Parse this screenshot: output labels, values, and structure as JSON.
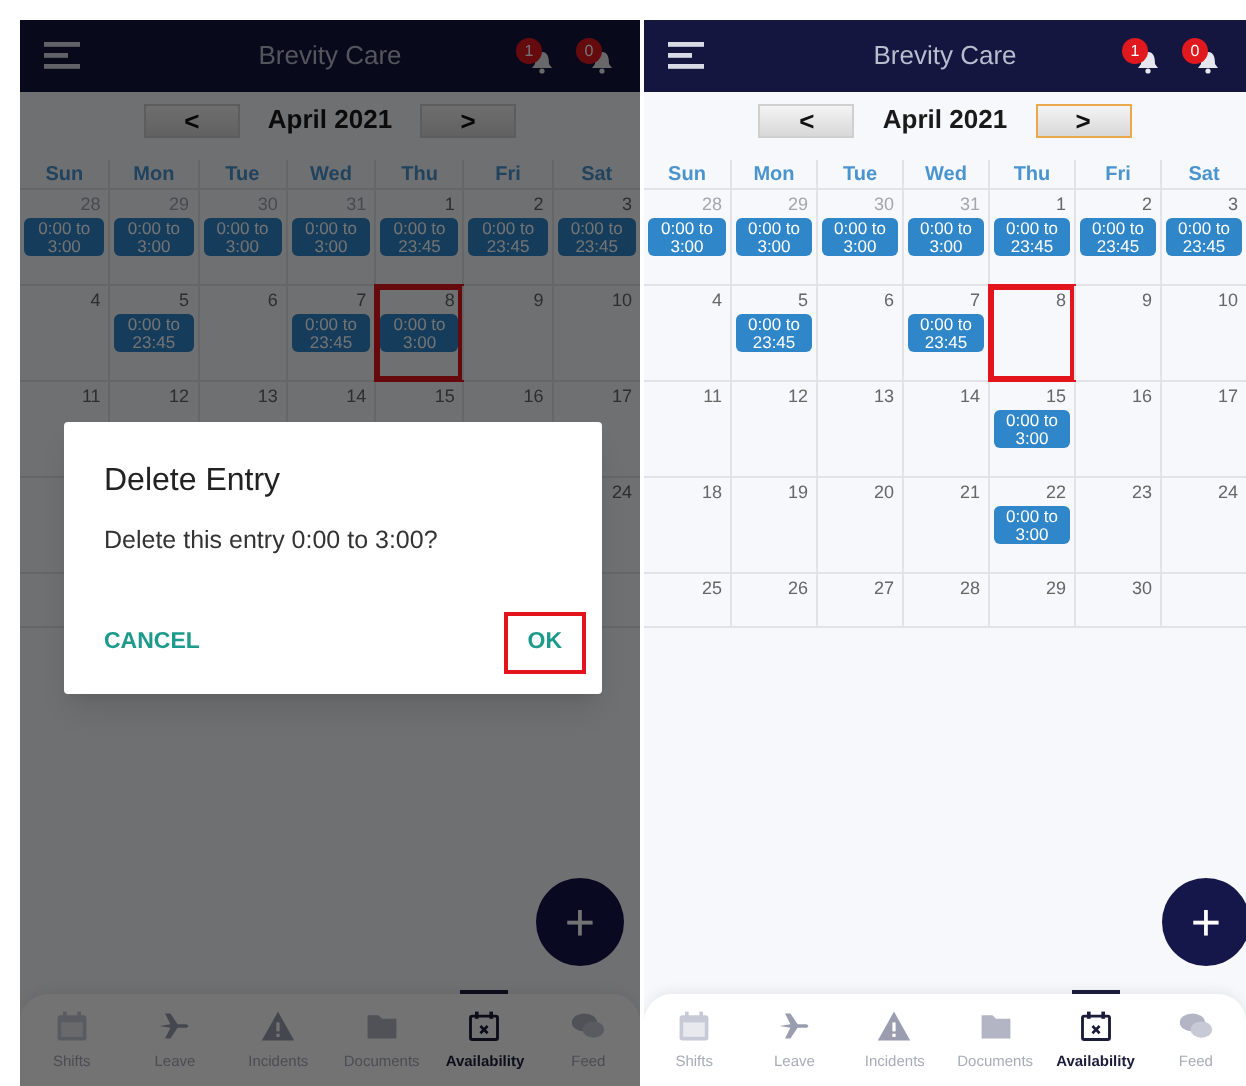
{
  "screens": [
    {
      "dimmed": true,
      "header": {
        "title": "Brevity Care",
        "badges": [
          "1",
          "0"
        ]
      },
      "month_nav": {
        "prev": "<",
        "label": "April 2021",
        "next": ">",
        "next_focused": false
      },
      "weekdays": [
        "Sun",
        "Mon",
        "Tue",
        "Wed",
        "Thu",
        "Fri",
        "Sat"
      ],
      "weeks": [
        [
          {
            "date": "28",
            "muted": true,
            "entry": "0:00 to 3:00",
            "highlighted": false
          },
          {
            "date": "29",
            "muted": true,
            "entry": "0:00 to 3:00",
            "highlighted": false
          },
          {
            "date": "30",
            "muted": true,
            "entry": "0:00 to 3:00",
            "highlighted": false
          },
          {
            "date": "31",
            "muted": true,
            "entry": "0:00 to 3:00",
            "highlighted": false
          },
          {
            "date": "1",
            "muted": false,
            "entry": "0:00 to 23:45",
            "highlighted": false
          },
          {
            "date": "2",
            "muted": false,
            "entry": "0:00 to 23:45",
            "highlighted": false
          },
          {
            "date": "3",
            "muted": false,
            "entry": "0:00 to 23:45",
            "highlighted": false
          }
        ],
        [
          {
            "date": "4",
            "muted": false,
            "highlighted": false
          },
          {
            "date": "5",
            "muted": false,
            "entry": "0:00 to 23:45",
            "highlighted": false
          },
          {
            "date": "6",
            "muted": false,
            "highlighted": false
          },
          {
            "date": "7",
            "muted": false,
            "entry": "0:00 to 23:45",
            "highlighted": false
          },
          {
            "date": "8",
            "muted": false,
            "entry": "0:00 to 3:00",
            "highlighted": true
          },
          {
            "date": "9",
            "muted": false,
            "highlighted": false
          },
          {
            "date": "10",
            "muted": false,
            "highlighted": false
          }
        ],
        [
          {
            "date": "11",
            "muted": false,
            "highlighted": false
          },
          {
            "date": "12",
            "muted": false,
            "highlighted": false
          },
          {
            "date": "13",
            "muted": false,
            "highlighted": false
          },
          {
            "date": "14",
            "muted": false,
            "highlighted": false
          },
          {
            "date": "15",
            "muted": false,
            "highlighted": false
          },
          {
            "date": "16",
            "muted": false,
            "highlighted": false
          },
          {
            "date": "17",
            "muted": false,
            "highlighted": false
          }
        ],
        [
          {
            "date": "24",
            "muted": false,
            "highlighted": false
          }
        ]
      ],
      "dialog": {
        "title": "Delete Entry",
        "message": "Delete this entry 0:00 to 3:00?",
        "cancel": "CANCEL",
        "ok": "OK",
        "ok_highlighted": true
      },
      "fab": "+",
      "tabs": [
        {
          "label": "Shifts",
          "selected": false
        },
        {
          "label": "Leave",
          "selected": false
        },
        {
          "label": "Incidents",
          "selected": false
        },
        {
          "label": "Documents",
          "selected": false
        },
        {
          "label": "Availability",
          "selected": true
        },
        {
          "label": "Feed",
          "selected": false
        }
      ]
    },
    {
      "dimmed": false,
      "header": {
        "title": "Brevity Care",
        "badges": [
          "1",
          "0"
        ]
      },
      "month_nav": {
        "prev": "<",
        "label": "April 2021",
        "next": ">",
        "next_focused": true
      },
      "weekdays": [
        "Sun",
        "Mon",
        "Tue",
        "Wed",
        "Thu",
        "Fri",
        "Sat"
      ],
      "weeks": [
        [
          {
            "date": "28",
            "muted": true,
            "entry": "0:00 to 3:00",
            "highlighted": false
          },
          {
            "date": "29",
            "muted": true,
            "entry": "0:00 to 3:00",
            "highlighted": false
          },
          {
            "date": "30",
            "muted": true,
            "entry": "0:00 to 3:00",
            "highlighted": false
          },
          {
            "date": "31",
            "muted": true,
            "entry": "0:00 to 3:00",
            "highlighted": false
          },
          {
            "date": "1",
            "muted": false,
            "entry": "0:00 to 23:45",
            "highlighted": false
          },
          {
            "date": "2",
            "muted": false,
            "entry": "0:00 to 23:45",
            "highlighted": false
          },
          {
            "date": "3",
            "muted": false,
            "entry": "0:00 to 23:45",
            "highlighted": false
          }
        ],
        [
          {
            "date": "4",
            "muted": false,
            "highlighted": false
          },
          {
            "date": "5",
            "muted": false,
            "entry": "0:00 to 23:45",
            "highlighted": false
          },
          {
            "date": "6",
            "muted": false,
            "highlighted": false
          },
          {
            "date": "7",
            "muted": false,
            "entry": "0:00 to 23:45",
            "highlighted": false
          },
          {
            "date": "8",
            "muted": false,
            "highlighted": true
          },
          {
            "date": "9",
            "muted": false,
            "highlighted": false
          },
          {
            "date": "10",
            "muted": false,
            "highlighted": false
          }
        ],
        [
          {
            "date": "11",
            "muted": false,
            "highlighted": false
          },
          {
            "date": "12",
            "muted": false,
            "highlighted": false
          },
          {
            "date": "13",
            "muted": false,
            "highlighted": false
          },
          {
            "date": "14",
            "muted": false,
            "highlighted": false
          },
          {
            "date": "15",
            "muted": false,
            "entry": "0:00 to 3:00",
            "highlighted": false
          },
          {
            "date": "16",
            "muted": false,
            "highlighted": false
          },
          {
            "date": "17",
            "muted": false,
            "highlighted": false
          }
        ],
        [
          {
            "date": "18",
            "muted": false,
            "highlighted": false
          },
          {
            "date": "19",
            "muted": false,
            "highlighted": false
          },
          {
            "date": "20",
            "muted": false,
            "highlighted": false
          },
          {
            "date": "21",
            "muted": false,
            "highlighted": false
          },
          {
            "date": "22",
            "muted": false,
            "entry": "0:00 to 3:00",
            "highlighted": false
          },
          {
            "date": "23",
            "muted": false,
            "highlighted": false
          },
          {
            "date": "24",
            "muted": false,
            "highlighted": false
          }
        ],
        [
          {
            "date": "25",
            "muted": false,
            "highlighted": false
          },
          {
            "date": "26",
            "muted": false,
            "highlighted": false
          },
          {
            "date": "27",
            "muted": false,
            "highlighted": false
          },
          {
            "date": "28",
            "muted": false,
            "highlighted": false
          },
          {
            "date": "29",
            "muted": false,
            "highlighted": false
          },
          {
            "date": "30",
            "muted": false,
            "highlighted": false
          }
        ]
      ],
      "fab": "+",
      "tabs": [
        {
          "label": "Shifts",
          "selected": false
        },
        {
          "label": "Leave",
          "selected": false
        },
        {
          "label": "Incidents",
          "selected": false
        },
        {
          "label": "Documents",
          "selected": false
        },
        {
          "label": "Availability",
          "selected": true
        },
        {
          "label": "Feed",
          "selected": false
        }
      ]
    }
  ]
}
